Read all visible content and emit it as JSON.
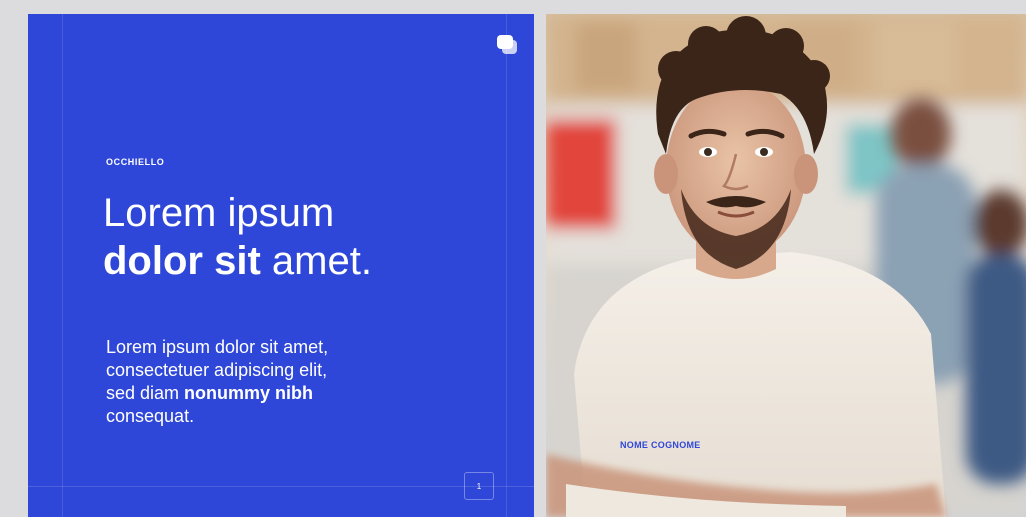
{
  "slide_text": {
    "eyebrow": "OCCHIELLO",
    "headline": {
      "line1": "Lorem ipsum",
      "line2_bold": "dolor sit",
      "line2_rest": " amet."
    },
    "body": {
      "line1": "Lorem ipsum dolor sit amet,",
      "line2": "consectetuer adipiscing elit,",
      "line3_lead": "sed diam ",
      "line3_bold": "nonummy nibh",
      "line4": "consequat."
    },
    "page_number": "1"
  },
  "photo_slide": {
    "name_label": "NOME COGNOME"
  },
  "colors": {
    "brand_blue": "#2f47d8",
    "text_on_blue": "#ffffff",
    "page_background": "#dcdcde"
  },
  "icons": {
    "brand": "chat-bubble-icon"
  }
}
